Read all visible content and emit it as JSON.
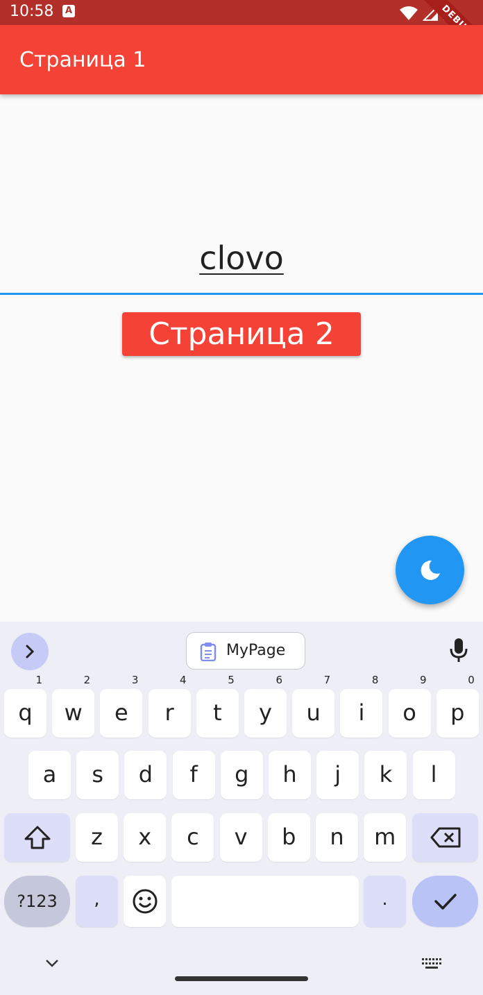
{
  "status_bar": {
    "time": "10:58",
    "debug_label": "DEBUG"
  },
  "app_bar": {
    "title": "Страница 1"
  },
  "text_field": {
    "value": "clovo"
  },
  "page2_button": {
    "label": "Страница 2"
  },
  "keyboard": {
    "clipboard_chip": "MyPage",
    "row1": [
      {
        "k": "q",
        "s": "1"
      },
      {
        "k": "w",
        "s": "2"
      },
      {
        "k": "e",
        "s": "3"
      },
      {
        "k": "r",
        "s": "4"
      },
      {
        "k": "t",
        "s": "5"
      },
      {
        "k": "y",
        "s": "6"
      },
      {
        "k": "u",
        "s": "7"
      },
      {
        "k": "i",
        "s": "8"
      },
      {
        "k": "o",
        "s": "9"
      },
      {
        "k": "p",
        "s": "0"
      }
    ],
    "row2": [
      "a",
      "s",
      "d",
      "f",
      "g",
      "h",
      "j",
      "k",
      "l"
    ],
    "row3": [
      "z",
      "x",
      "c",
      "v",
      "b",
      "n",
      "m"
    ],
    "symbols_key": "?123",
    "comma_key": ",",
    "period_key": "."
  },
  "colors": {
    "app_bar": "#f44336",
    "status_bar": "#b3302a",
    "accent": "#2196f3"
  }
}
